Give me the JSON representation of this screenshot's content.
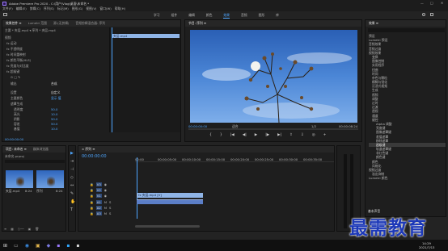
{
  "titlebar": {
    "title": "Adobe Premiere Pro 2020 - C:\\用户\\Vlog\\桌面\\未命名 *"
  },
  "menubar": [
    "文件(F)",
    "编辑(E)",
    "剪辑(C)",
    "序列(S)",
    "标记(M)",
    "图形(G)",
    "视图(V)",
    "窗口(W)",
    "帮助(H)"
  ],
  "workspaces": [
    "学习",
    "组件",
    "编辑",
    "颜色",
    "效果",
    "音频",
    "图形",
    "库"
  ],
  "effect_controls": {
    "tabs": [
      "效果控件 ≡",
      "Lumetri 范围",
      "源:(无剪辑)",
      "音频剪辑混合器: 序列"
    ],
    "header": "主要 * 夹层.mp4 ▾ 序列 * 夹层.mp4",
    "clip_label": "夹层.mp4",
    "rows": [
      "视频",
      "fx 运动",
      "fx 不透明度",
      "fx 时间重映射",
      "fx 颜色平衡(HLS)",
      "fx 亮度与对比度",
      "fx 超级键",
      "⊙ □ ✎",
      "主要颜色",
      "遮罩生成",
      "输出",
      "设置",
      "透明度",
      "高光",
      "阴影",
      "容差",
      "基值",
      "遮罩清除",
      "溢出抑制",
      "颜色校正",
      "音频",
      "fx 音量",
      "fx 声道音量",
      "fx 声像器"
    ],
    "values": {
      "output": "合成",
      "setting": "自定义",
      "transparency": "50.0",
      "highlight": "10.0",
      "shadow": "50.0",
      "tolerance": "50.0",
      "pedestal": "10.0",
      "key_color_label": "显示 值"
    },
    "timecode": "00:00:00:00"
  },
  "program_monitor": {
    "tab": "节目: 序列 ≡",
    "timecode_left": "00:00:00:00",
    "fit": "适合",
    "scale": "1/2",
    "timecode_right": "00:00:08:24"
  },
  "project": {
    "tabs": [
      "项目: 未命名 ≡",
      "媒体浏览器"
    ],
    "name": "未命名.prproj",
    "items": [
      {
        "label": "夹层.mp4",
        "dur": "8:24"
      },
      {
        "label": "序列",
        "dur": "8:24"
      }
    ]
  },
  "timeline": {
    "tab": "× 序列 ≡",
    "timecode": "00:00:00:00",
    "ruler": [
      "00:00",
      "00:00:05:00",
      "00:00:10:00",
      "00:00:15:00",
      "00:00:20:00",
      "00:00:25:00",
      "00:00:30:00",
      "00:00:35:00",
      "00:00:40:00"
    ],
    "tracks": [
      "V3",
      "V2",
      "V1",
      "A1",
      "A2",
      "A3"
    ],
    "clips": [
      {
        "label": "fx 夹层.mp4 [V]",
        "track": "V1"
      },
      {
        "label": "",
        "track": "A1"
      }
    ]
  },
  "effects": {
    "tab": "效果 ≡",
    "items": [
      "预设",
      "Lumetri 预设",
      "音频效果",
      "音频过渡",
      "视频效果",
      "变换",
      "图像控制",
      "实用程序",
      "扭曲",
      "时间",
      "杂色与颗粒",
      "模糊与锐化",
      "沉浸式视频",
      "生成",
      "视频",
      "调整",
      "过时",
      "过渡",
      "透视",
      "通道",
      "键控",
      "Alpha 调整",
      "亮度键",
      "图像遮罩键",
      "差值遮罩",
      "移除遮罩",
      "超级键",
      "轨道遮罩键",
      "非红色键",
      "颜色键",
      "颜色",
      "风格化",
      "视频过渡",
      "溢出抑制"
    ],
    "lumetri": "Lumetri 颜色",
    "bottom": "基本声音"
  },
  "taskbar": {
    "time": "14:29",
    "date": "2021/7/13"
  },
  "watermark": "最需教育",
  "colors": {
    "accent": "#2d8ceb",
    "clip_blue": "#8fb4e6",
    "timeline_blue": "#5b7ec7",
    "playhead": "#4ea6ff"
  }
}
